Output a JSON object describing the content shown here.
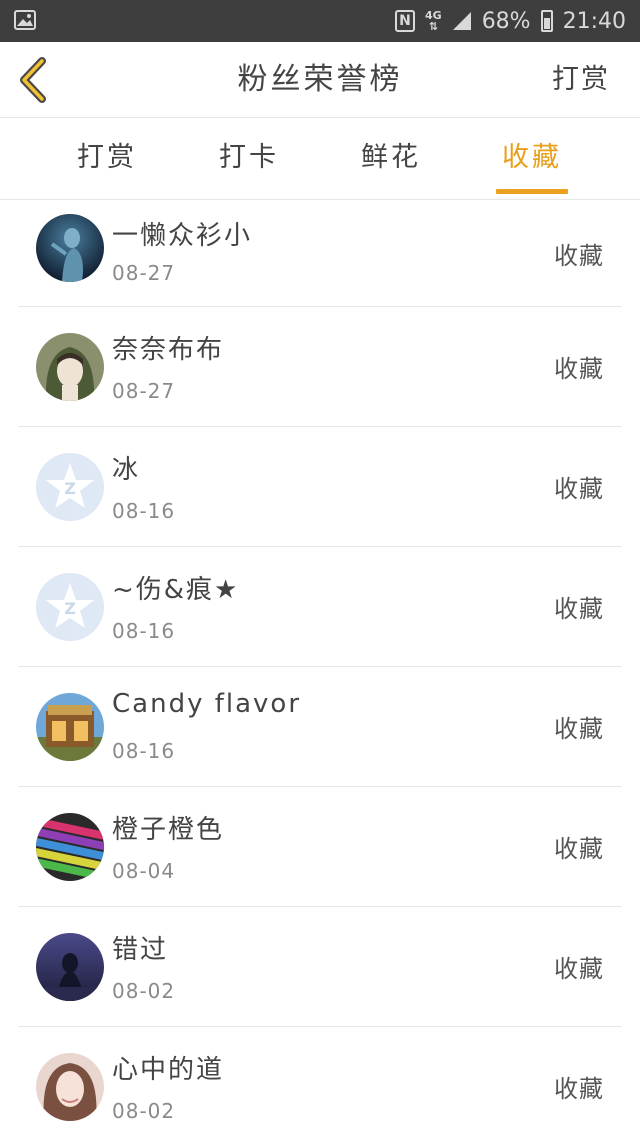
{
  "status_bar": {
    "icons": [
      "image-icon",
      "nfc-icon",
      "4g-icon",
      "signal-icon",
      "battery-icon"
    ],
    "network": "4G",
    "battery": "68%",
    "time": "21:40"
  },
  "header": {
    "back_icon": "chevron-left-icon",
    "title": "粉丝荣誉榜",
    "action_label": "打赏"
  },
  "tabs": [
    {
      "label": "打赏",
      "active": false
    },
    {
      "label": "打卡",
      "active": false
    },
    {
      "label": "鲜花",
      "active": false
    },
    {
      "label": "收藏",
      "active": true
    }
  ],
  "colors": {
    "accent": "#eba020",
    "status_bar_bg": "#3e3e3e",
    "text": "#444444",
    "muted": "#8a8a8a"
  },
  "list": [
    {
      "name": "一懒众衫小",
      "date": "08-27",
      "action": "收藏",
      "avatar": "dark-figure-avatar"
    },
    {
      "name": "奈奈布布",
      "date": "08-27",
      "action": "收藏",
      "avatar": "hooded-girl-avatar"
    },
    {
      "name": "冰",
      "date": "08-16",
      "action": "收藏",
      "avatar": "default-qzone-avatar"
    },
    {
      "name": "~伤&痕★",
      "date": "08-16",
      "action": "收藏",
      "avatar": "default-qzone-avatar"
    },
    {
      "name": "Candy flavor",
      "date": "08-16",
      "action": "收藏",
      "avatar": "shop-front-avatar"
    },
    {
      "name": "橙子橙色",
      "date": "08-04",
      "action": "收藏",
      "avatar": "colored-pencils-avatar"
    },
    {
      "name": "错过",
      "date": "08-02",
      "action": "收藏",
      "avatar": "night-silhouette-avatar"
    },
    {
      "name": "心中的道",
      "date": "08-02",
      "action": "收藏",
      "avatar": "girl-portrait-avatar"
    }
  ]
}
